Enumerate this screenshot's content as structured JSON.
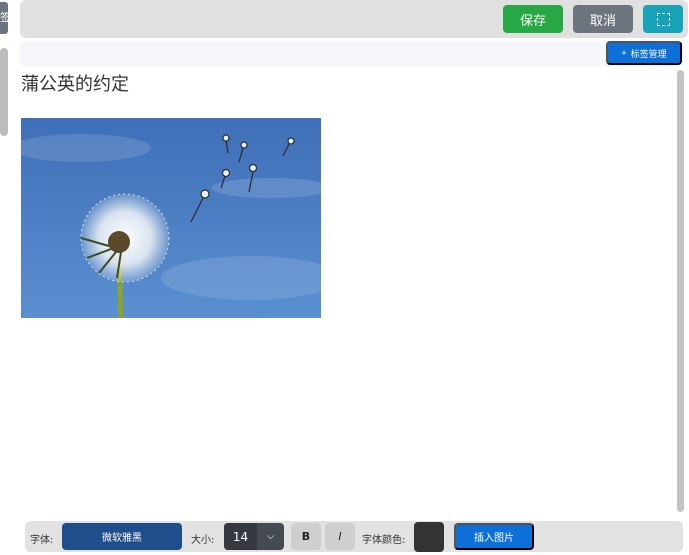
{
  "toolbar": {
    "save_label": "保存",
    "cancel_label": "取消",
    "fullscreen_icon": "fullscreen-icon"
  },
  "tagbar": {
    "plus": "+",
    "manage_label": "标签管理"
  },
  "left_tab": {
    "label": "签"
  },
  "editor": {
    "title": "蒲公英的约定",
    "image": {
      "icon": "dandelion-photo"
    }
  },
  "format_bar": {
    "font_label": "字体:",
    "font_value": "微软雅黑",
    "size_label": "大小:",
    "size_value": "14",
    "bold_label": "B",
    "italic_label": "I",
    "color_label": "字体颜色:",
    "color_value": "#333333",
    "insert_image_label": "插入图片"
  },
  "colors": {
    "save": "#28a745",
    "cancel": "#6c757d",
    "fullscreen": "#17a2b8",
    "primary": "#0d6fd8",
    "font_select": "#1f4e8c"
  }
}
